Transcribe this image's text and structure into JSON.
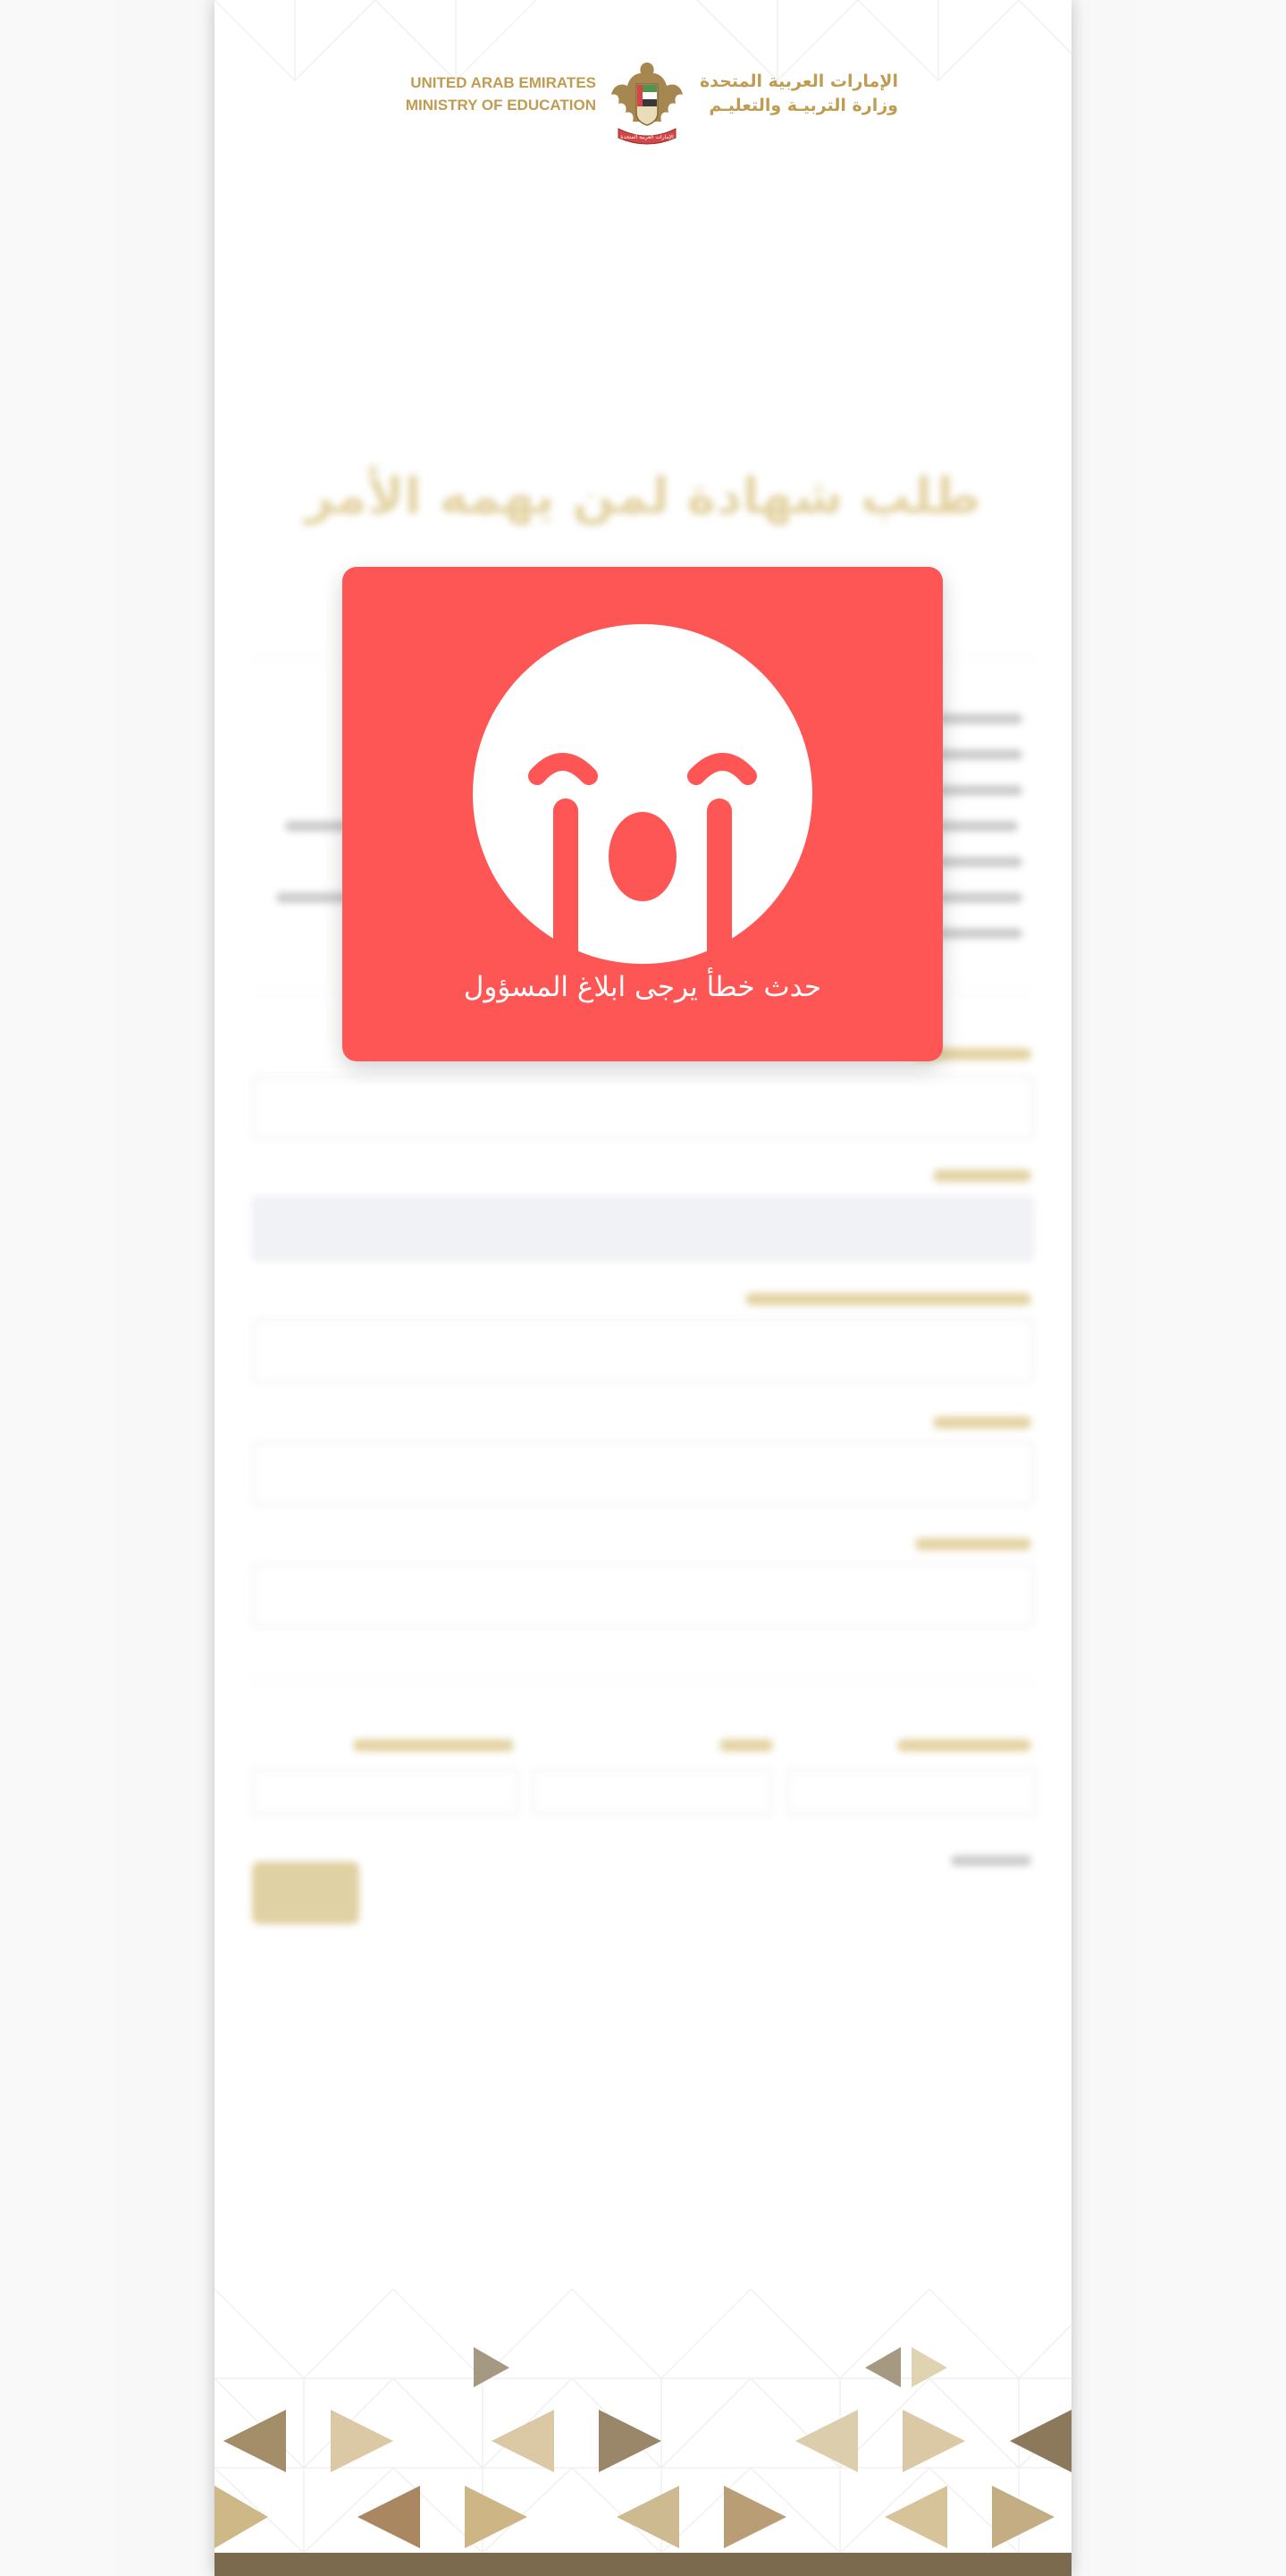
{
  "header": {
    "country_en": "UNITED ARAB EMIRATES",
    "ministry_en": "MINISTRY OF EDUCATION",
    "country_ar": "الإمارات العربية المتحدة",
    "ministry_ar": "وزارة التربيـة والتعليـم",
    "emblem_text": "الإمارات العربية المتحدة"
  },
  "form": {
    "title": "طلب شهادة لمن يهمه الأمر"
  },
  "error_dialog": {
    "message": "حدث خطأ يرجى ابلاغ المسؤول",
    "icon": "crying-face-icon"
  },
  "colors": {
    "error_background": "#fe5555",
    "brand_gold": "#b8913f",
    "footer_brown": "#6e5a3a"
  }
}
